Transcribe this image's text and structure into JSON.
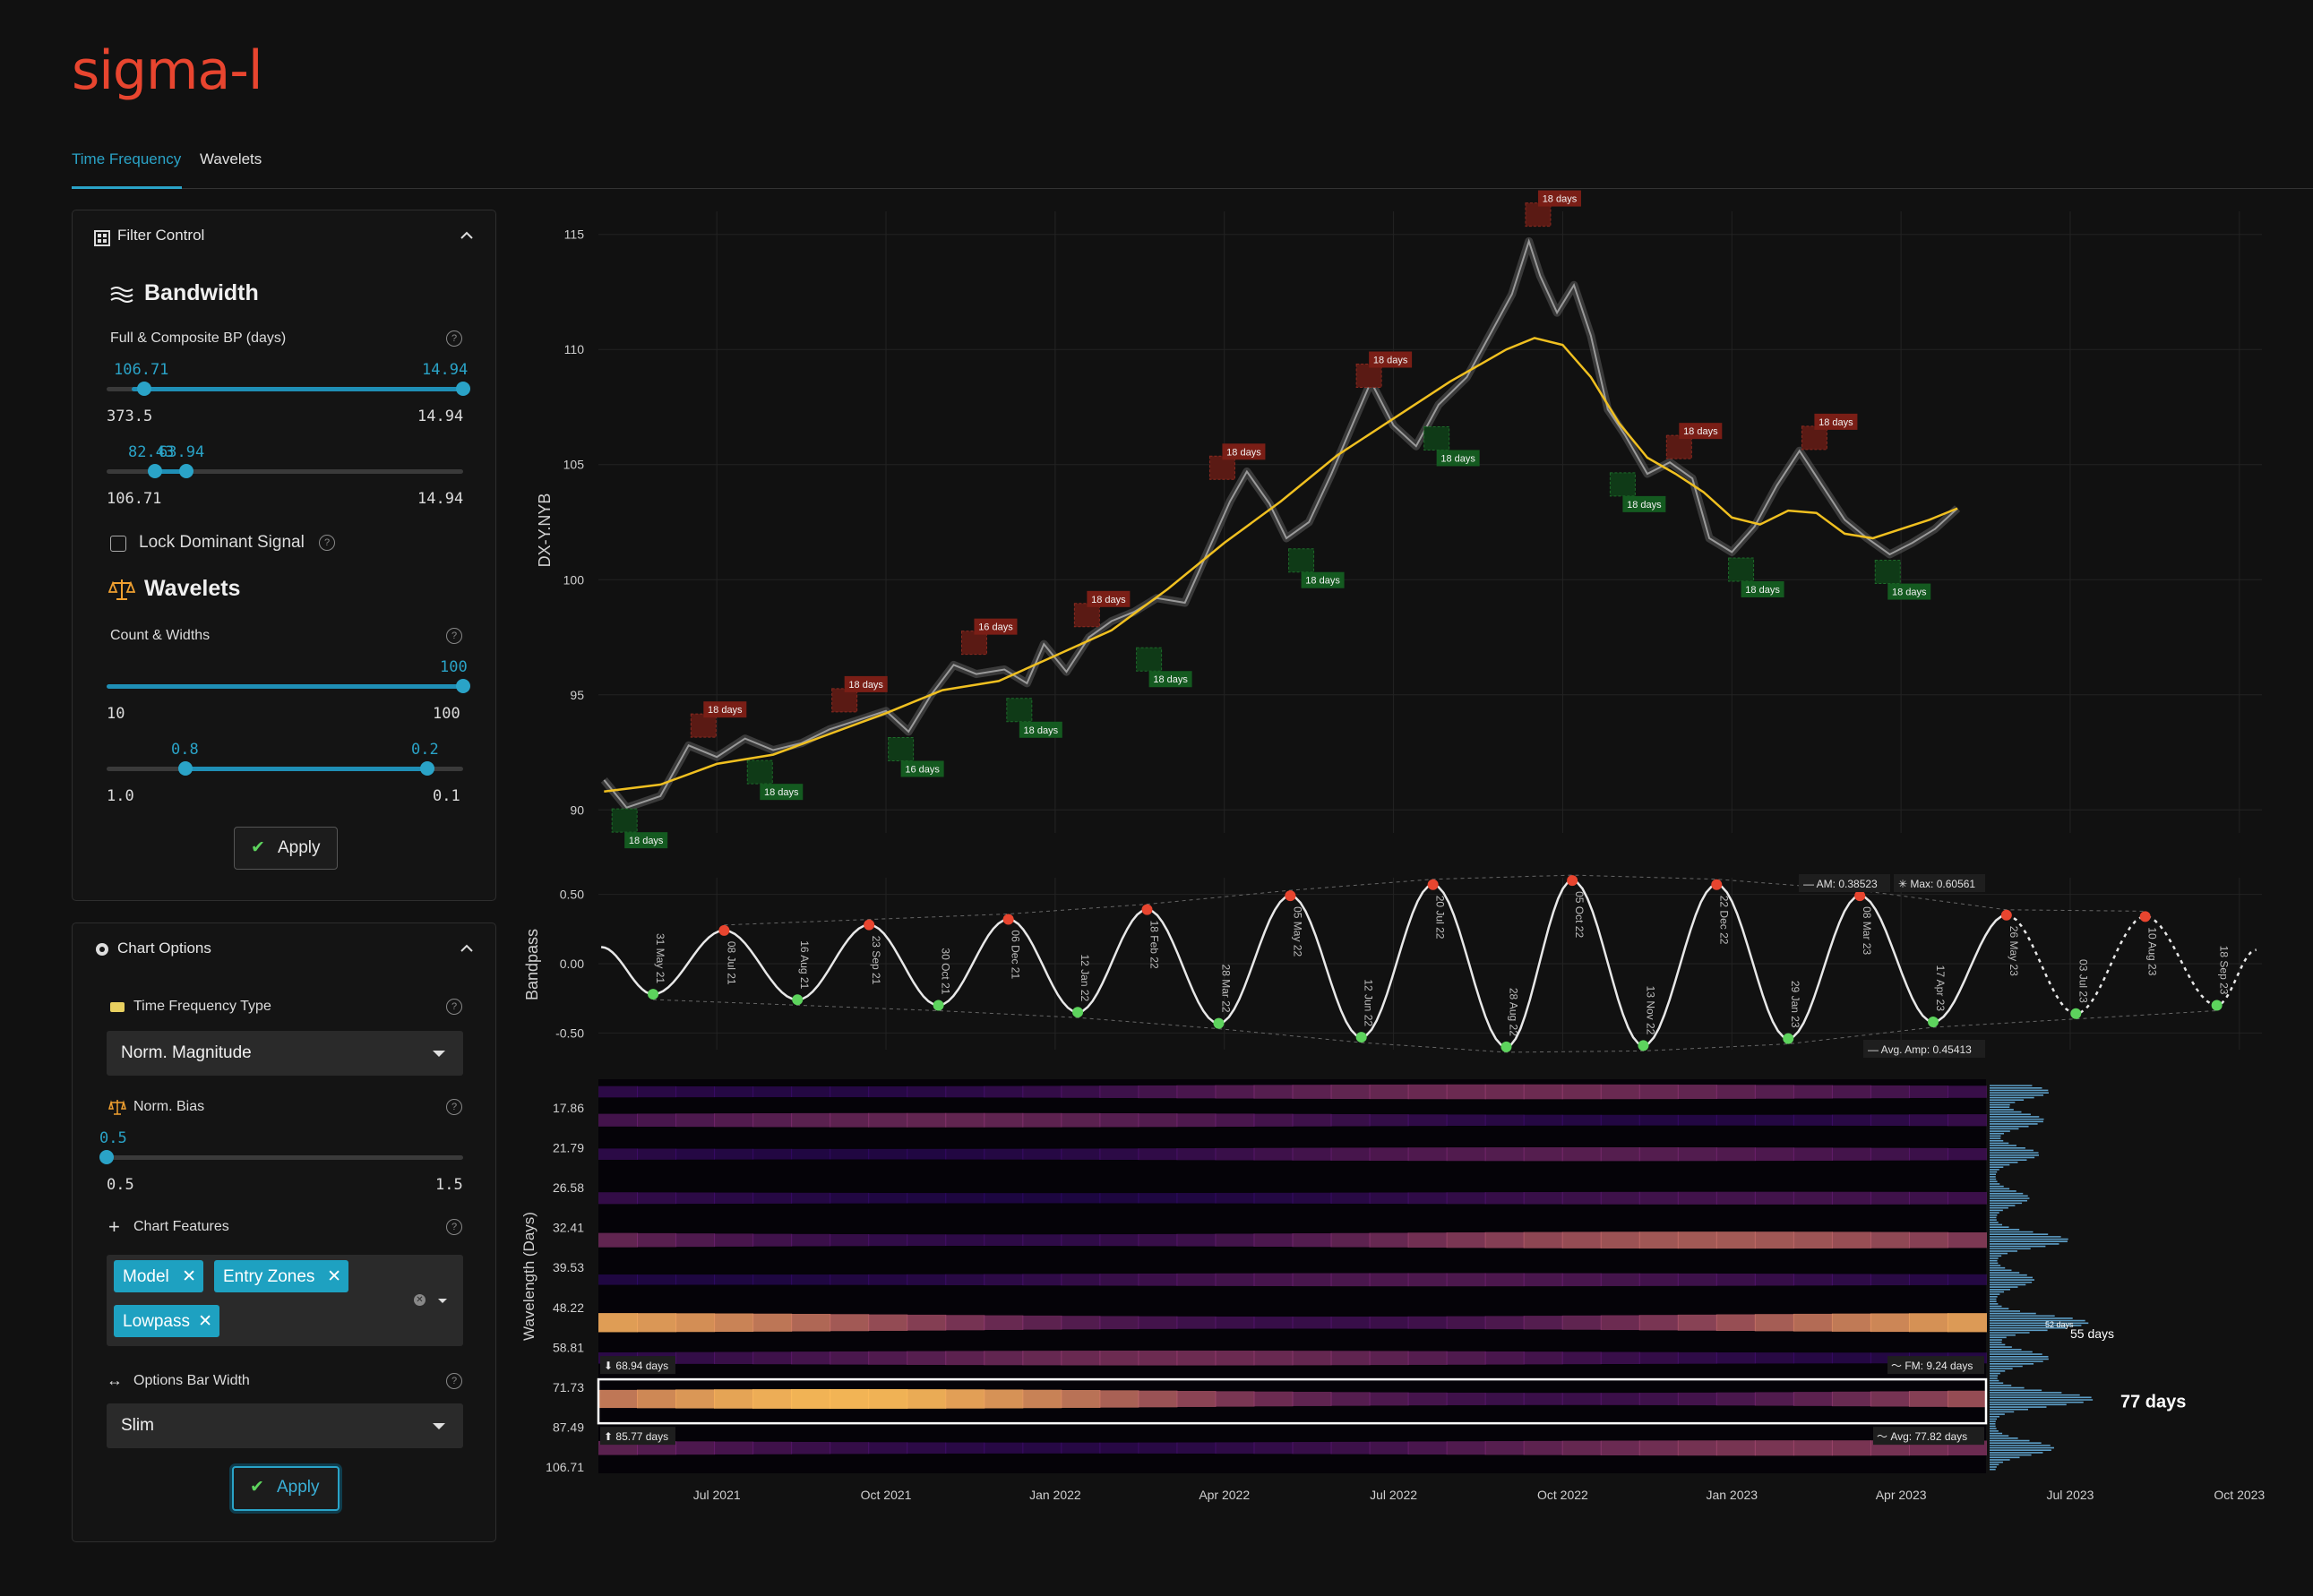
{
  "app": {
    "logo": "sigma-l"
  },
  "tabs": [
    {
      "label": "Time Frequency",
      "active": true
    },
    {
      "label": "Wavelets",
      "active": false
    }
  ],
  "filter_control": {
    "title": "Filter Control",
    "bandwidth": {
      "heading": "Bandwidth",
      "label": "Full & Composite BP (days)",
      "slider1": {
        "low_value": "106.71",
        "high_value": "14.94",
        "min_label": "373.5",
        "max_label": "14.94",
        "low_pos": 0.07,
        "high_pos": 1.0
      },
      "slider2": {
        "low_value": "82.43",
        "high_value": "63.94",
        "min_label": "106.71",
        "max_label": "14.94",
        "low_pos": 0.13,
        "high_pos": 0.22
      }
    },
    "lock_dominant": {
      "label": "Lock Dominant Signal",
      "checked": false
    },
    "wavelets": {
      "heading": "Wavelets",
      "label": "Count & Widths",
      "slider1": {
        "value": "100",
        "min_label": "10",
        "max_label": "100",
        "pos": 1.0
      },
      "slider2": {
        "low_value": "0.8",
        "high_value": "0.2",
        "min_label": "1.0",
        "max_label": "0.1",
        "low_pos": 0.22,
        "high_pos": 0.89
      }
    },
    "apply_label": "Apply"
  },
  "chart_options": {
    "title": "Chart Options",
    "tf_type": {
      "label": "Time Frequency Type",
      "value": "Norm. Magnitude"
    },
    "norm_bias": {
      "label": "Norm. Bias",
      "value": "0.5",
      "min_label": "0.5",
      "max_label": "1.5",
      "pos": 0.0
    },
    "features": {
      "label": "Chart Features",
      "chips": [
        "Model",
        "Entry Zones",
        "Lowpass"
      ]
    },
    "bar_width": {
      "label": "Options Bar Width",
      "value": "Slim"
    },
    "apply_label": "Apply"
  },
  "colors": {
    "accent": "#2aa3c7",
    "logo": "#e8452f",
    "lowpass": "#f0c020",
    "peak": "#e8452f",
    "trough": "#5dd35d"
  },
  "chart_data": [
    {
      "type": "line",
      "ylabel": "DX-Y.NYB",
      "ylim": [
        89,
        116
      ],
      "y_ticks": [
        "90",
        "95",
        "100",
        "105",
        "110",
        "115"
      ],
      "x_ticks": [
        "Jul 2021",
        "Oct 2021",
        "Jan 2022",
        "Apr 2022",
        "Jul 2022",
        "Oct 2022",
        "Jan 2023",
        "Apr 2023",
        "Jul 2023",
        "Oct 2023"
      ],
      "x_month_index": [
        3,
        6,
        9,
        12,
        15,
        18,
        21,
        24,
        27,
        30
      ],
      "x_range_months": [
        0.9,
        30.4
      ],
      "price": [
        [
          1.0,
          91.3
        ],
        [
          1.4,
          90.1
        ],
        [
          2.0,
          90.6
        ],
        [
          2.5,
          92.8
        ],
        [
          3.0,
          92.3
        ],
        [
          3.5,
          93.1
        ],
        [
          4.0,
          92.6
        ],
        [
          4.5,
          92.9
        ],
        [
          5.0,
          93.5
        ],
        [
          5.5,
          93.9
        ],
        [
          6.0,
          94.3
        ],
        [
          6.4,
          93.4
        ],
        [
          6.8,
          95.0
        ],
        [
          7.2,
          96.3
        ],
        [
          7.6,
          95.9
        ],
        [
          8.1,
          96.1
        ],
        [
          8.5,
          95.5
        ],
        [
          8.8,
          97.2
        ],
        [
          9.2,
          96.0
        ],
        [
          9.6,
          97.5
        ],
        [
          10.0,
          98.2
        ],
        [
          10.4,
          98.6
        ],
        [
          10.8,
          99.2
        ],
        [
          11.3,
          99.0
        ],
        [
          11.7,
          101.2
        ],
        [
          12.1,
          103.4
        ],
        [
          12.4,
          104.7
        ],
        [
          12.8,
          103.3
        ],
        [
          13.1,
          101.8
        ],
        [
          13.5,
          102.5
        ],
        [
          13.9,
          104.6
        ],
        [
          14.3,
          106.9
        ],
        [
          14.6,
          108.6
        ],
        [
          15.0,
          106.7
        ],
        [
          15.4,
          105.8
        ],
        [
          15.8,
          107.6
        ],
        [
          16.3,
          108.8
        ],
        [
          16.7,
          110.6
        ],
        [
          17.1,
          112.4
        ],
        [
          17.4,
          114.7
        ],
        [
          17.6,
          113.2
        ],
        [
          17.9,
          111.6
        ],
        [
          18.2,
          112.8
        ],
        [
          18.5,
          110.6
        ],
        [
          18.8,
          107.4
        ],
        [
          19.1,
          106.3
        ],
        [
          19.5,
          104.6
        ],
        [
          19.9,
          105.1
        ],
        [
          20.3,
          104.4
        ],
        [
          20.6,
          101.8
        ],
        [
          21.0,
          101.2
        ],
        [
          21.4,
          102.3
        ],
        [
          21.8,
          104.1
        ],
        [
          22.2,
          105.6
        ],
        [
          22.6,
          104.1
        ],
        [
          23.0,
          102.6
        ],
        [
          23.4,
          101.8
        ],
        [
          23.8,
          101.1
        ],
        [
          24.2,
          101.6
        ],
        [
          24.6,
          102.2
        ],
        [
          25.0,
          103.1
        ]
      ],
      "lowpass": [
        [
          1.0,
          90.8
        ],
        [
          2.0,
          91.1
        ],
        [
          3.0,
          92.0
        ],
        [
          4.0,
          92.4
        ],
        [
          5.0,
          93.3
        ],
        [
          6.0,
          94.2
        ],
        [
          7.0,
          95.2
        ],
        [
          8.0,
          95.6
        ],
        [
          9.0,
          96.7
        ],
        [
          10.0,
          97.8
        ],
        [
          11.0,
          99.6
        ],
        [
          12.0,
          101.6
        ],
        [
          13.0,
          103.4
        ],
        [
          14.0,
          105.4
        ],
        [
          15.0,
          107.0
        ],
        [
          16.0,
          108.6
        ],
        [
          17.0,
          110.0
        ],
        [
          17.5,
          110.5
        ],
        [
          18.0,
          110.2
        ],
        [
          18.5,
          108.8
        ],
        [
          19.0,
          106.8
        ],
        [
          19.5,
          105.3
        ],
        [
          20.0,
          104.6
        ],
        [
          20.5,
          103.8
        ],
        [
          21.0,
          102.7
        ],
        [
          21.5,
          102.4
        ],
        [
          22.0,
          103.0
        ],
        [
          22.5,
          102.9
        ],
        [
          23.0,
          102.0
        ],
        [
          23.5,
          101.8
        ],
        [
          24.0,
          102.2
        ],
        [
          24.5,
          102.6
        ],
        [
          25.0,
          103.1
        ]
      ],
      "entry_zones": [
        {
          "kind": "trough",
          "label": "18 days",
          "x": 1.3,
          "y": 90.2
        },
        {
          "kind": "peak",
          "label": "18 days",
          "x": 2.7,
          "y": 93.0
        },
        {
          "kind": "trough",
          "label": "18 days",
          "x": 3.7,
          "y": 92.3
        },
        {
          "kind": "peak",
          "label": "18 days",
          "x": 5.2,
          "y": 94.1
        },
        {
          "kind": "trough",
          "label": "16 days",
          "x": 6.2,
          "y": 93.3
        },
        {
          "kind": "peak",
          "label": "16 days",
          "x": 7.5,
          "y": 96.6
        },
        {
          "kind": "trough",
          "label": "18 days",
          "x": 8.3,
          "y": 95.0
        },
        {
          "kind": "peak",
          "label": "18 days",
          "x": 9.5,
          "y": 97.8
        },
        {
          "kind": "trough",
          "label": "18 days",
          "x": 10.6,
          "y": 97.2
        },
        {
          "kind": "peak",
          "label": "18 days",
          "x": 11.9,
          "y": 104.2
        },
        {
          "kind": "trough",
          "label": "18 days",
          "x": 13.3,
          "y": 101.5
        },
        {
          "kind": "peak",
          "label": "18 days",
          "x": 14.5,
          "y": 108.2
        },
        {
          "kind": "trough",
          "label": "18 days",
          "x": 15.7,
          "y": 106.8
        },
        {
          "kind": "peak",
          "label": "18 days",
          "x": 17.5,
          "y": 115.2
        },
        {
          "kind": "trough",
          "label": "18 days",
          "x": 19.0,
          "y": 104.8
        },
        {
          "kind": "peak",
          "label": "18 days",
          "x": 20.0,
          "y": 105.1
        },
        {
          "kind": "trough",
          "label": "18 days",
          "x": 21.1,
          "y": 101.1
        },
        {
          "kind": "peak",
          "label": "18 days",
          "x": 22.4,
          "y": 105.5
        },
        {
          "kind": "trough",
          "label": "18 days",
          "x": 23.7,
          "y": 101.0
        }
      ]
    },
    {
      "type": "line",
      "ylabel": "Bandpass",
      "ylim": [
        -0.62,
        0.62
      ],
      "y_ticks": [
        "0.50",
        "0.00",
        "-0.50"
      ],
      "annotations": {
        "am": "— AM: 0.38523",
        "max": "✳ Max: 0.60561",
        "avg_amp": "— Avg. Amp: 0.45413"
      },
      "turns": [
        {
          "kind": "trough",
          "date": "31 May 21",
          "x": 1.87,
          "y": -0.22
        },
        {
          "kind": "peak",
          "date": "08 Jul 21",
          "x": 3.13,
          "y": 0.24
        },
        {
          "kind": "trough",
          "date": "16 Aug 21",
          "x": 4.43,
          "y": -0.26
        },
        {
          "kind": "peak",
          "date": "23 Sep 21",
          "x": 5.7,
          "y": 0.28
        },
        {
          "kind": "trough",
          "date": "30 Oct 21",
          "x": 6.93,
          "y": -0.3
        },
        {
          "kind": "peak",
          "date": "06 Dec 21",
          "x": 8.17,
          "y": 0.32
        },
        {
          "kind": "trough",
          "date": "12 Jan 22",
          "x": 9.4,
          "y": -0.35
        },
        {
          "kind": "peak",
          "date": "18 Feb 22",
          "x": 10.63,
          "y": 0.39
        },
        {
          "kind": "trough",
          "date": "28 Mar 22",
          "x": 11.9,
          "y": -0.43
        },
        {
          "kind": "peak",
          "date": "05 May 22",
          "x": 13.17,
          "y": 0.49
        },
        {
          "kind": "trough",
          "date": "12 Jun 22",
          "x": 14.43,
          "y": -0.53
        },
        {
          "kind": "peak",
          "date": "20 Jul 22",
          "x": 15.7,
          "y": 0.57
        },
        {
          "kind": "trough",
          "date": "28 Aug 22",
          "x": 17.0,
          "y": -0.6
        },
        {
          "kind": "peak",
          "date": "05 Oct 22",
          "x": 18.17,
          "y": 0.6
        },
        {
          "kind": "trough",
          "date": "13 Nov 22",
          "x": 19.43,
          "y": -0.59
        },
        {
          "kind": "peak",
          "date": "22 Dec 22",
          "x": 20.73,
          "y": 0.57
        },
        {
          "kind": "trough",
          "date": "29 Jan 23",
          "x": 22.0,
          "y": -0.54
        },
        {
          "kind": "peak",
          "date": "08 Mar 23",
          "x": 23.27,
          "y": 0.49
        },
        {
          "kind": "trough",
          "date": "17 Apr 23",
          "x": 24.57,
          "y": -0.42
        },
        {
          "kind": "peak",
          "date": "26 May 23",
          "x": 25.87,
          "y": 0.35
        },
        {
          "kind": "trough",
          "date": "03 Jul 23",
          "x": 27.1,
          "y": -0.36
        },
        {
          "kind": "peak",
          "date": "10 Aug 23",
          "x": 28.33,
          "y": 0.34
        },
        {
          "kind": "trough",
          "date": "18 Sep 23",
          "x": 29.6,
          "y": -0.3
        }
      ],
      "projection_start_x": 25.87
    },
    {
      "type": "heatmap",
      "ylabel": "Wavelength (Days)",
      "y_ticks": [
        "17.86",
        "21.79",
        "26.58",
        "32.41",
        "39.53",
        "48.22",
        "58.81",
        "71.73",
        "87.49",
        "106.71"
      ],
      "bands": [
        {
          "wavelength": 16.5,
          "intensity": 0.55
        },
        {
          "wavelength": 19.0,
          "intensity": 0.5
        },
        {
          "wavelength": 22.5,
          "intensity": 0.45
        },
        {
          "wavelength": 28.0,
          "intensity": 0.35
        },
        {
          "wavelength": 34.5,
          "intensity": 0.75
        },
        {
          "wavelength": 42.0,
          "intensity": 0.4
        },
        {
          "wavelength": 52.0,
          "intensity": 0.95
        },
        {
          "wavelength": 62.0,
          "intensity": 0.55
        },
        {
          "wavelength": 76.0,
          "intensity": 1.0
        },
        {
          "wavelength": 97.0,
          "intensity": 0.6
        }
      ],
      "selection": {
        "upper_label": "⬇ 68.94 days",
        "lower_label": "⬆ 85.77 days",
        "fm_label": "〜 FM: 9.24 days",
        "avg_label": "〜 Avg: 77.82 days"
      },
      "side_labels": [
        {
          "text": "77 days",
          "wavelength": 77,
          "size": "large"
        },
        {
          "text": "55 days",
          "wavelength": 55,
          "size": "small"
        },
        {
          "text": "52 days",
          "wavelength": 52.5,
          "size": "tiny"
        }
      ],
      "x_ticks": [
        "Jul 2021",
        "Oct 2021",
        "Jan 2022",
        "Apr 2022",
        "Jul 2022",
        "Oct 2022",
        "Jan 2023",
        "Apr 2023",
        "Jul 2023",
        "Oct 2023"
      ]
    }
  ]
}
